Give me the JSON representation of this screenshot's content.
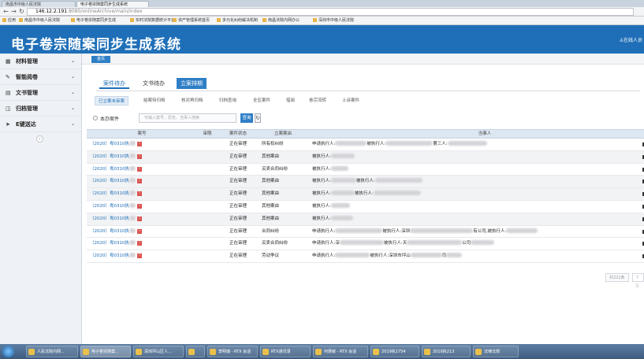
{
  "browser": {
    "tabs": [
      {
        "label": "南昌市中级人民法院"
      },
      {
        "label": "电子卷宗随案同步生成系统"
      }
    ],
    "url_host": "146.12.2.191",
    "url_rest": ":8080/onlineArchive/main/index",
    "bookmarks": [
      {
        "label": "应用"
      },
      {
        "label": "南昌市中级人民法院"
      },
      {
        "label": "电子卷宗随案同步生成"
      },
      {
        "label": "实时法院数据统计平台"
      },
      {
        "label": "资产管理系统首页"
      },
      {
        "label": "多元化纠纷解决机制"
      },
      {
        "label": "南昌法院内网办公"
      },
      {
        "label": "深圳市中级人民法院"
      }
    ]
  },
  "header": {
    "title": "电子卷宗随案同步生成系统",
    "user": "在线人员"
  },
  "sidebar": {
    "items": [
      {
        "label": "材料管理",
        "icon": "table-icon"
      },
      {
        "label": "智能阅卷",
        "icon": "pencil-icon"
      },
      {
        "label": "文书管理",
        "icon": "document-icon"
      },
      {
        "label": "归档管理",
        "icon": "archive-icon"
      },
      {
        "label": "E键送达",
        "icon": "send-icon"
      }
    ]
  },
  "breadcrumb": {
    "home": "首页"
  },
  "main": {
    "top_tabs": [
      {
        "label": "案件待办"
      },
      {
        "label": "文书待办"
      },
      {
        "label": "立案排期"
      }
    ],
    "sub_tabs": [
      {
        "label": "已立案未审案"
      },
      {
        "label": "结案待归档"
      },
      {
        "label": "核对再归档"
      },
      {
        "label": "归档查询"
      },
      {
        "label": "全区案件"
      },
      {
        "label": "借阅"
      },
      {
        "label": "卷宗流转"
      },
      {
        "label": "上诉案件"
      }
    ],
    "filter": {
      "radio_label": "本办案件",
      "search_placeholder": "可输入案号、原告、当事人搜索",
      "search_button": "查询",
      "refresh_icon": "refresh-icon"
    },
    "table": {
      "headers": [
        "案号",
        "审限",
        "案件状态",
        "立案案由",
        "当事人"
      ],
      "rows": [
        {
          "case_no": "（2020）粤0310执",
          "status": "正在审理",
          "cause": "所有权纠纷",
          "party_prefix": "申请执行人:",
          "party_mid": "被执行人:",
          "party_tail": "第三人:"
        },
        {
          "case_no": "（2020）粤0310执",
          "status": "正在审理",
          "cause": "其他案由",
          "party_prefix": "被执行人:",
          "party_mid": "",
          "party_tail": ""
        },
        {
          "case_no": "（2020）粤0310执",
          "status": "正在审理",
          "cause": "买卖合同纠纷",
          "party_prefix": "被执行人:",
          "party_mid": "",
          "party_tail": ""
        },
        {
          "case_no": "（2020）粤0310执",
          "status": "正在审理",
          "cause": "其他案由",
          "party_prefix": "被执行人:",
          "party_mid": "被执行人:",
          "party_tail": ""
        },
        {
          "case_no": "（2020）粤0310执",
          "status": "正在审理",
          "cause": "其他案由",
          "party_prefix": "被执行人:",
          "party_mid": "被执行人:",
          "party_tail": ""
        },
        {
          "case_no": "（2020）粤0310执",
          "status": "正在审理",
          "cause": "其他案由",
          "party_prefix": "被执行人:",
          "party_mid": "",
          "party_tail": ""
        },
        {
          "case_no": "（2020）粤0310执",
          "status": "正在审理",
          "cause": "其他案由",
          "party_prefix": "被执行人:",
          "party_mid": "",
          "party_tail": ""
        },
        {
          "case_no": "（2020）粤0310执",
          "status": "正在审理",
          "cause": "合同纠纷",
          "party_prefix": "申请执行人:",
          "party_mid": "被执行人:深圳",
          "party_tail": "有公司,被执行人:"
        },
        {
          "case_no": "（2020）粤0310执",
          "status": "正在审理",
          "cause": "买卖合同纠纷",
          "party_prefix": "申请执行人:深",
          "party_mid": "被执行人:天",
          "party_tail": "公司"
        },
        {
          "case_no": "（2020）粤0310执",
          "status": "正在审理",
          "cause": "劳动争议",
          "party_prefix": "申请执行人:",
          "party_mid": "被执行人:深圳市坪山",
          "party_tail": "司"
        }
      ]
    },
    "pager": {
      "total": "共221条",
      "next": "下页"
    }
  },
  "taskbar": {
    "items": [
      {
        "label": "人民法院内网..."
      },
      {
        "label": "电子卷宗随案..."
      },
      {
        "label": "深圳坪山区人..."
      },
      {
        "label": ""
      },
      {
        "label": "李明瑞 - RTX 会话"
      },
      {
        "label": "RTX通讯录"
      },
      {
        "label": "何惠敏 - RTX 会话"
      },
      {
        "label": "2019执1754"
      },
      {
        "label": "2019执213"
      },
      {
        "label": "法律法规"
      }
    ]
  }
}
